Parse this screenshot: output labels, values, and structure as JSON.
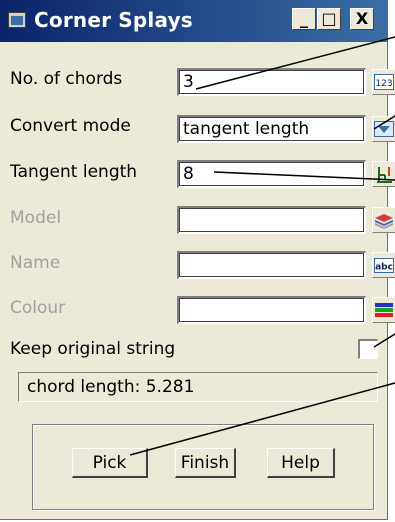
{
  "window": {
    "title": "Corner Splays",
    "minimize_glyph": "_",
    "maximize_glyph": "□",
    "close_glyph": "X"
  },
  "form": {
    "chords": {
      "label": "No. of chords",
      "value": "3",
      "button_icon": "calculator-123-icon"
    },
    "convert_mode": {
      "label": "Convert mode",
      "value": "tangent length",
      "button_icon": "dropdown-arrow-icon"
    },
    "tangent_length": {
      "label": "Tangent length",
      "value": "8",
      "button_icon": "pick-measure-icon"
    },
    "model": {
      "label": "Model",
      "value": "",
      "button_icon": "model-layers-icon",
      "disabled": true
    },
    "name": {
      "label": "Name",
      "value": "",
      "button_icon": "abc-text-icon",
      "disabled": true
    },
    "colour": {
      "label": "Colour",
      "value": "",
      "button_icon": "colour-bars-icon",
      "disabled": true
    },
    "keep_original": {
      "label": "Keep original string",
      "checked": false
    }
  },
  "status": {
    "text": "chord length: 5.281"
  },
  "buttons": {
    "pick": "Pick",
    "finish": "Finish",
    "help": "Help"
  },
  "colors": {
    "titlebar_start": "#0a246a",
    "titlebar_end": "#3a6ea5",
    "dialog_bg": "#ece9d8",
    "disabled_text": "#a0a0a0",
    "arrow": "#000000"
  }
}
